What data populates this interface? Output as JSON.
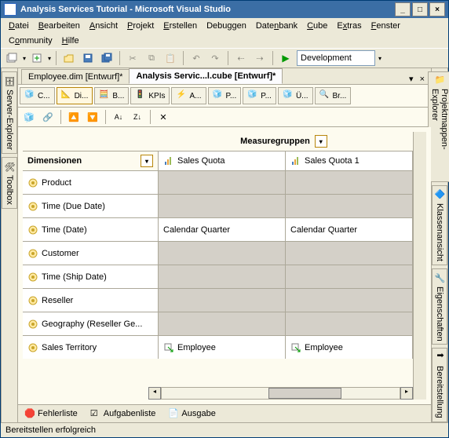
{
  "title": "Analysis Services Tutorial - Microsoft Visual Studio",
  "menus": {
    "file": "Datei",
    "edit": "Bearbeiten",
    "view": "Ansicht",
    "project": "Projekt",
    "build": "Erstellen",
    "debug": "Debuggen",
    "database": "Datenbank",
    "cube": "Cube",
    "extras": "Extras",
    "window": "Fenster",
    "community": "Community",
    "help": "Hilfe"
  },
  "toolbar": {
    "config": "Development"
  },
  "leftrail": {
    "server": "Server-Explorer",
    "toolbox": "Toolbox"
  },
  "rightrail": {
    "solution": "Projektmappen-Explorer",
    "class": "Klassenansicht",
    "props": "Eigenschaften",
    "deploy": "Bereitstellung"
  },
  "doctabs": {
    "t1": "Employee.dim [Entwurf]*",
    "t2": "Analysis Servic...l.cube [Entwurf]*"
  },
  "designtabs": {
    "t1": "C...",
    "t2": "Di...",
    "t3": "B...",
    "t4": "KPIs",
    "t5": "A...",
    "t6": "P...",
    "t7": "P...",
    "t8": "Ü...",
    "t9": "Br..."
  },
  "grid": {
    "dim_header": "Dimensionen",
    "mg_header": "Measuregruppen",
    "mg_cols": [
      "Sales Quota",
      "Sales Quota 1"
    ],
    "rows": [
      {
        "dim": "Product",
        "cells": [
          "",
          ""
        ],
        "gray": [
          true,
          true
        ]
      },
      {
        "dim": "Time (Due Date)",
        "cells": [
          "",
          ""
        ],
        "gray": [
          true,
          true
        ]
      },
      {
        "dim": "Time (Date)",
        "cells": [
          "Calendar Quarter",
          "Calendar Quarter"
        ],
        "gray": [
          false,
          false
        ]
      },
      {
        "dim": "Customer",
        "cells": [
          "",
          ""
        ],
        "gray": [
          true,
          true
        ]
      },
      {
        "dim": "Time (Ship Date)",
        "cells": [
          "",
          ""
        ],
        "gray": [
          true,
          true
        ]
      },
      {
        "dim": "Reseller",
        "cells": [
          "",
          ""
        ],
        "gray": [
          true,
          true
        ]
      },
      {
        "dim": "Geography (Reseller Ge...",
        "cells": [
          "",
          ""
        ],
        "gray": [
          true,
          true
        ]
      },
      {
        "dim": "Sales Territory",
        "cells": [
          "Employee",
          "Employee"
        ],
        "gray": [
          false,
          false
        ],
        "icon": "out"
      }
    ]
  },
  "bottom": {
    "err": "Fehlerliste",
    "task": "Aufgabenliste",
    "out": "Ausgabe"
  },
  "status": "Bereitstellen erfolgreich"
}
